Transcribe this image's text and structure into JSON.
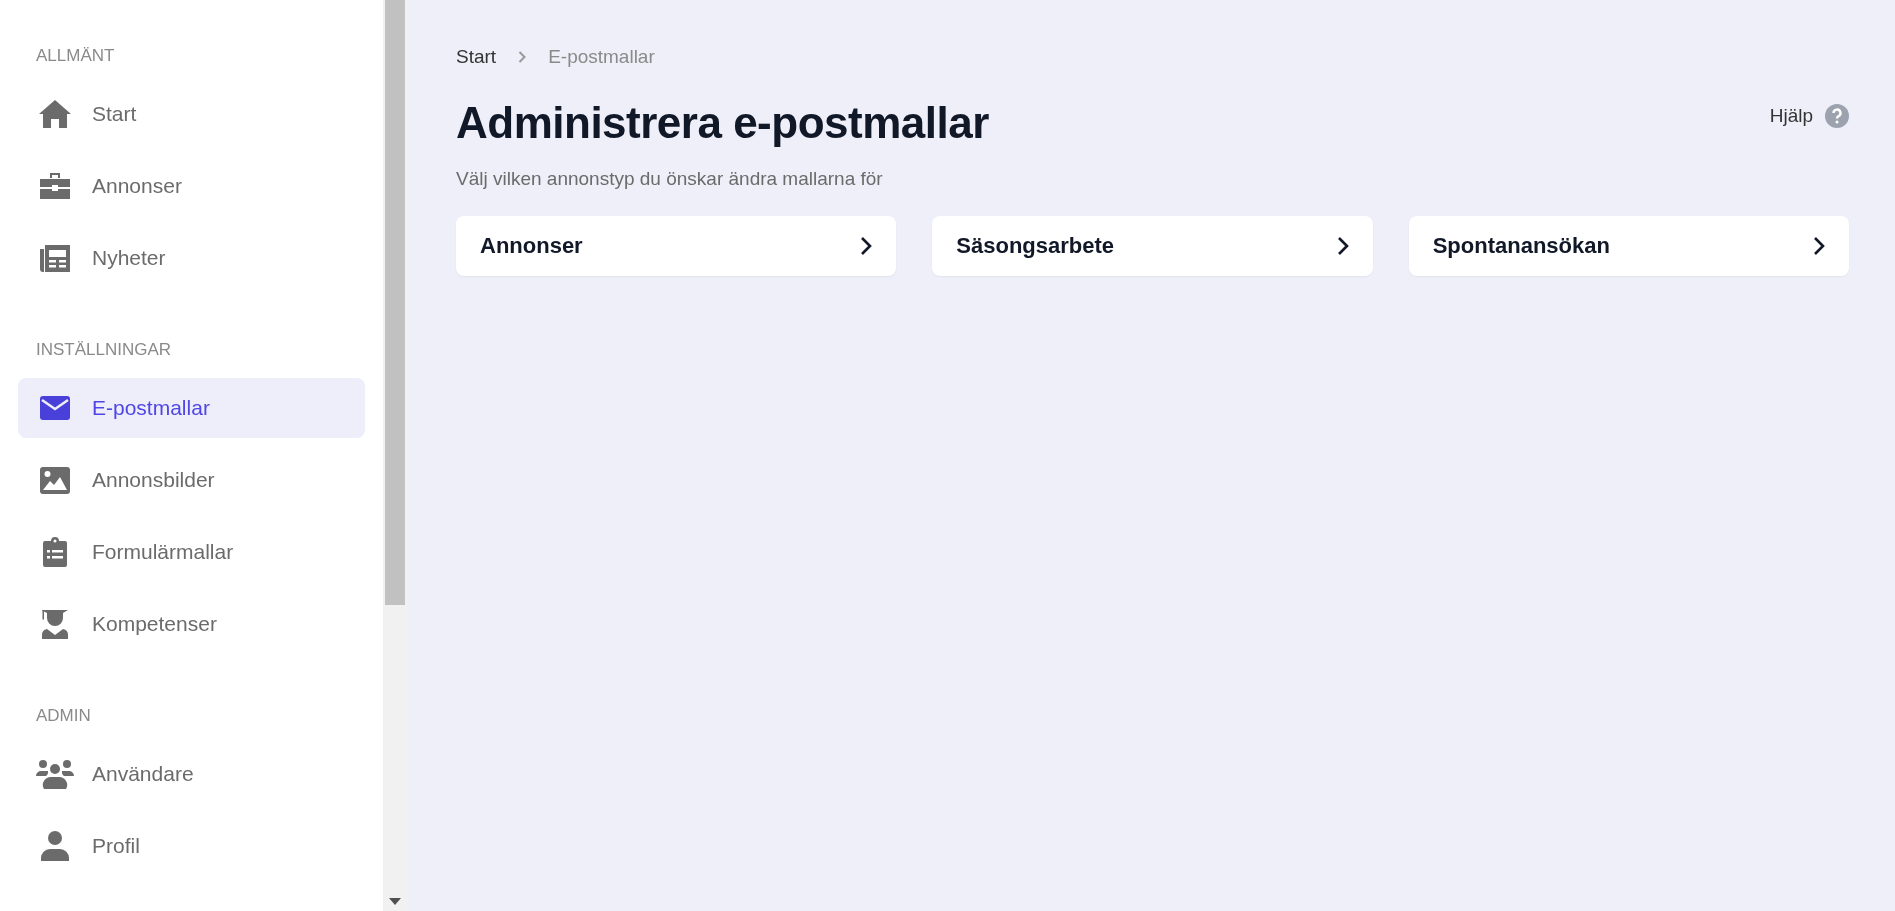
{
  "sidebar": {
    "sections": [
      {
        "heading": "ALLMÄNT",
        "items": [
          {
            "label": "Start",
            "kind": "home",
            "selected": false
          },
          {
            "label": "Annonser",
            "kind": "briefcase",
            "selected": false
          },
          {
            "label": "Nyheter",
            "kind": "newspaper",
            "selected": false
          }
        ]
      },
      {
        "heading": "INSTÄLLNINGAR",
        "items": [
          {
            "label": "E-postmallar",
            "kind": "mail",
            "selected": true
          },
          {
            "label": "Annonsbilder",
            "kind": "image",
            "selected": false
          },
          {
            "label": "Formulärmallar",
            "kind": "clipboard",
            "selected": false
          },
          {
            "label": "Kompetenser",
            "kind": "graduate",
            "selected": false
          }
        ]
      },
      {
        "heading": "ADMIN",
        "items": [
          {
            "label": "Användare",
            "kind": "users",
            "selected": false
          },
          {
            "label": "Profil",
            "kind": "user",
            "selected": false
          }
        ]
      }
    ]
  },
  "breadcrumb": [
    "Start",
    "E-postmallar"
  ],
  "title": "Administrera e-postmallar",
  "help": "Hjälp",
  "subtitle": "Välj vilken annonstyp du önskar ändra mallarna för",
  "cards": [
    "Annonser",
    "Säsongsarbete",
    "Spontanansökan"
  ]
}
